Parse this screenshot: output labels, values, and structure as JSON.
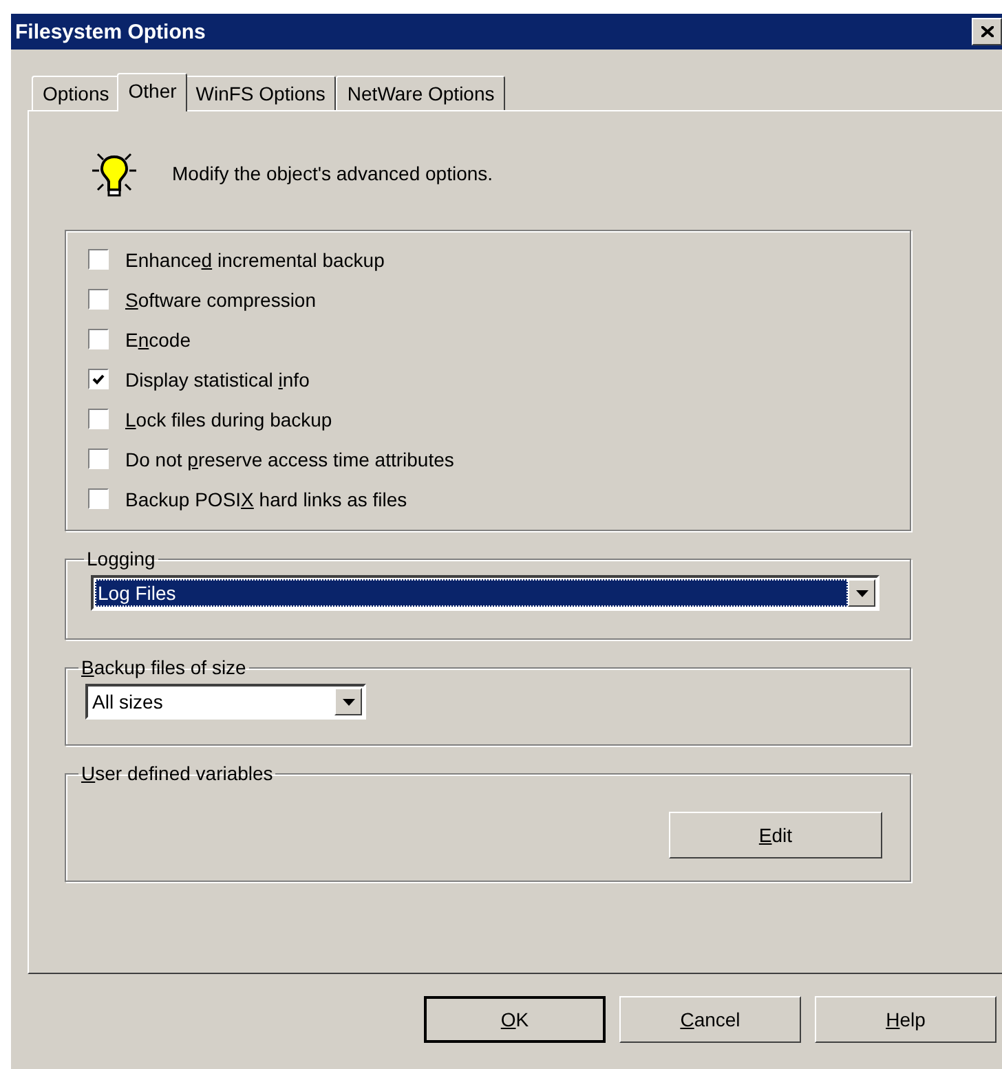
{
  "window": {
    "title": "Filesystem Options"
  },
  "tabs": [
    {
      "label": "Options",
      "selected": false
    },
    {
      "label": "Other",
      "selected": true
    },
    {
      "label": "WinFS Options",
      "selected": false
    },
    {
      "label": "NetWare Options",
      "selected": false
    }
  ],
  "header": {
    "text": "Modify the object's advanced options."
  },
  "options": [
    {
      "pre": "Enhance",
      "key": "d",
      "post": " incremental backup",
      "checked": false
    },
    {
      "key": "S",
      "post": "oftware compression",
      "checked": false
    },
    {
      "pre": "E",
      "key": "n",
      "post": "code",
      "checked": false
    },
    {
      "pre": "Display statistical ",
      "key": "i",
      "post": "nfo",
      "checked": true
    },
    {
      "key": "L",
      "post": "ock files during backup",
      "checked": false
    },
    {
      "pre": "Do not ",
      "key": "p",
      "post": "reserve access time attributes",
      "checked": false
    },
    {
      "pre": "Backup POSI",
      "key": "X",
      "post": " hard links as files",
      "checked": false
    }
  ],
  "logging": {
    "label": {
      "pre": "Logging"
    },
    "value": "Log Files",
    "focused": true
  },
  "backup_size": {
    "label": {
      "key": "B",
      "post": "ackup files of size"
    },
    "value": "All sizes",
    "focused": false
  },
  "user_variables": {
    "label": {
      "key": "U",
      "post": "ser defined variables"
    },
    "button": {
      "key": "E",
      "post": "dit"
    }
  },
  "buttons": [
    {
      "key": "O",
      "post": "K",
      "default": true
    },
    {
      "key": "C",
      "post": "ancel",
      "default": false
    },
    {
      "key": "H",
      "post": "elp",
      "default": false
    }
  ]
}
